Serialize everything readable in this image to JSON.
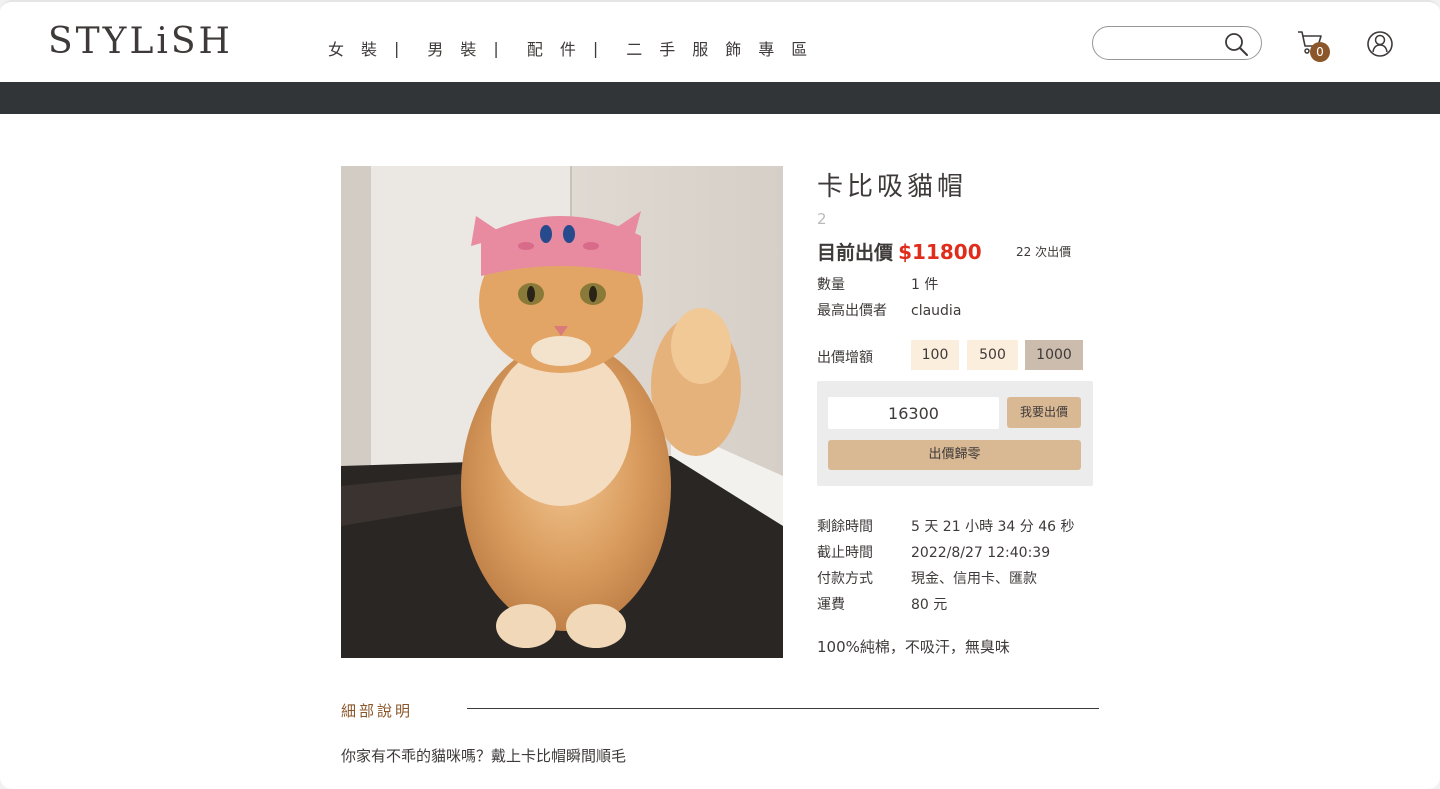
{
  "header": {
    "logo": "STYLiSH",
    "nav": [
      "女裝",
      "男裝",
      "配件",
      "二手服飾專區"
    ],
    "nav_separator": "|",
    "search_placeholder": "",
    "cart_count": "0",
    "icons": {
      "search": "search-icon",
      "cart": "cart-icon",
      "member": "member-icon"
    }
  },
  "product": {
    "title": "卡比吸貓帽",
    "id": "2",
    "price_label": "目前出價",
    "price_value": "$11800",
    "bid_count": "22 次出價",
    "quantity_label": "數量",
    "quantity_value": "1 件",
    "top_bidder_label": "最高出價者",
    "top_bidder_value": "claudia",
    "increment_label": "出價增額",
    "increments": [
      "100",
      "500",
      "1000"
    ],
    "selected_increment": "1000",
    "bid_input_value": "16300",
    "bid_button": "我要出價",
    "reset_button": "出價歸零",
    "remaining_label": "剩餘時間",
    "remaining_value": "5 天 21 小時 34 分 46 秒",
    "deadline_label": "截止時間",
    "deadline_value": "2022/8/27 12:40:39",
    "payment_label": "付款方式",
    "payment_value": "現金、信用卡、匯款",
    "shipping_label": "運費",
    "shipping_value": "80 元",
    "description": "100%純棉，不吸汗，無臭味"
  },
  "details": {
    "title": "細部說明",
    "text": "你家有不乖的貓咪嗎？戴上卡比帽瞬間順毛"
  },
  "colors": {
    "accent_price": "#e02d1b",
    "brand_brown": "#8b572a",
    "button_tan": "#d9b994",
    "increment_bg": "#fbeedd",
    "increment_active": "#cbbcad",
    "dark_bar": "#313538"
  }
}
